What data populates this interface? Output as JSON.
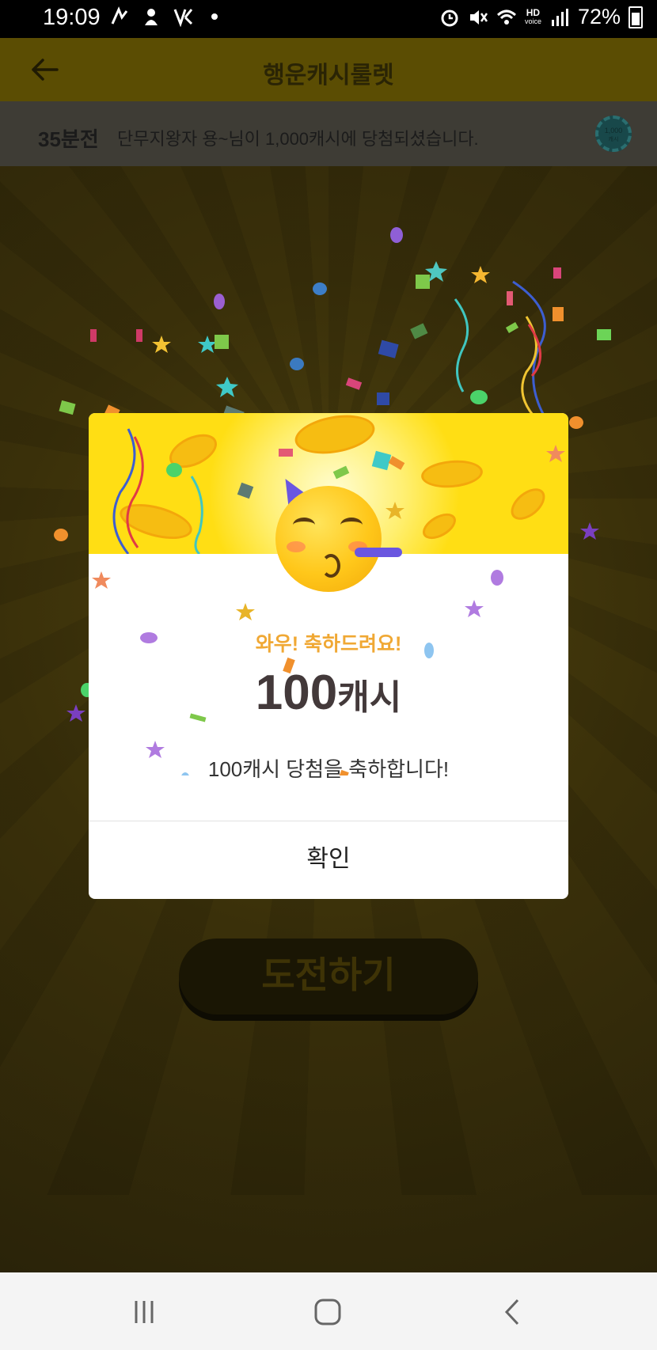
{
  "status_bar": {
    "time": "19:09",
    "hd_label": "HD",
    "voice_label": "voice",
    "battery": "72%"
  },
  "header": {
    "title": "행운캐시룰렛"
  },
  "ticker": {
    "time_ago": "35분전",
    "message": "단무지왕자 용~님이 1,000캐시에 당첨되셨습니다.",
    "chip_value": "1,000",
    "chip_unit": "캐시"
  },
  "background": {
    "challenge_button": "도전하기"
  },
  "dialog": {
    "headline": "와우! 축하드려요!",
    "amount": "100",
    "unit": "캐시",
    "description": "100캐시 당첨을 축하합니다!",
    "confirm_label": "확인"
  },
  "colors": {
    "banner_yellow": "#ffde14",
    "headline_orange": "#f0a834",
    "amount_text": "#43393a"
  },
  "icons": [
    "back-arrow-icon",
    "alarm-icon",
    "mute-icon",
    "wifi-icon",
    "signal-icon",
    "battery-icon",
    "recents-icon",
    "home-icon",
    "back-nav-icon",
    "party-face-icon"
  ]
}
